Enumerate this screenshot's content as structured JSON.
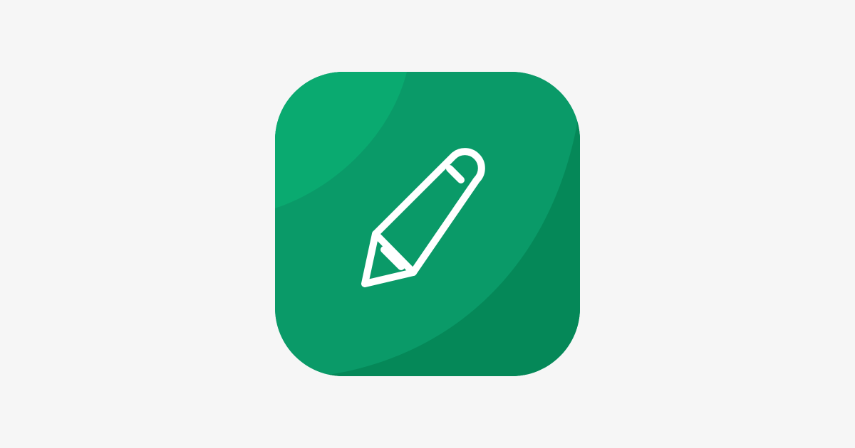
{
  "page": {
    "background": "#f6f6f6"
  },
  "app_icon": {
    "icon_name": "pencil-icon",
    "colors": {
      "light_green": "#0aaa70",
      "mid_green": "#0a9a68",
      "dark_green": "#058858",
      "glyph": "#ffffff"
    }
  }
}
